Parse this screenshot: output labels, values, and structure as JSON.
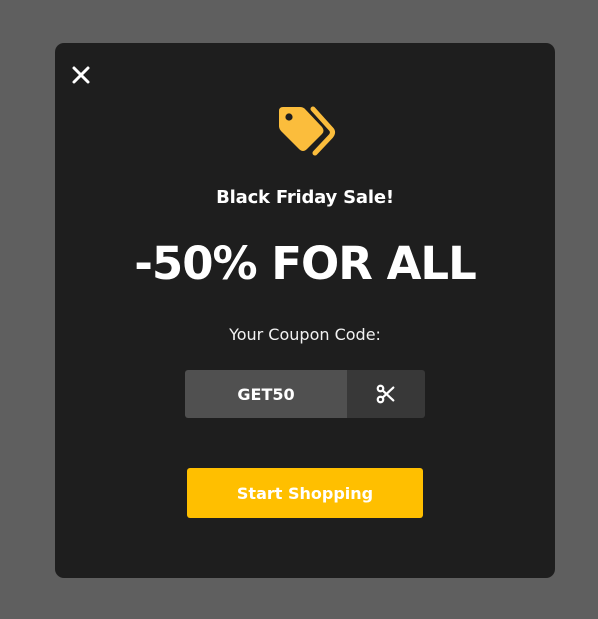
{
  "modal": {
    "subtitle": "Black Friday Sale!",
    "headline": "-50% FOR ALL",
    "coupon_label": "Your Coupon Code:",
    "coupon_code": "GET50",
    "cta_label": "Start Shopping"
  },
  "icons": {
    "close": "close-icon",
    "tag": "tags-icon",
    "copy": "scissors-icon"
  },
  "colors": {
    "overlay": "#5f5f5f",
    "modal_bg": "#1e1e1e",
    "accent": "#ffbf00",
    "tag_icon": "#fbbd3c",
    "coupon_bg": "#505050",
    "copy_bg": "#383838"
  }
}
